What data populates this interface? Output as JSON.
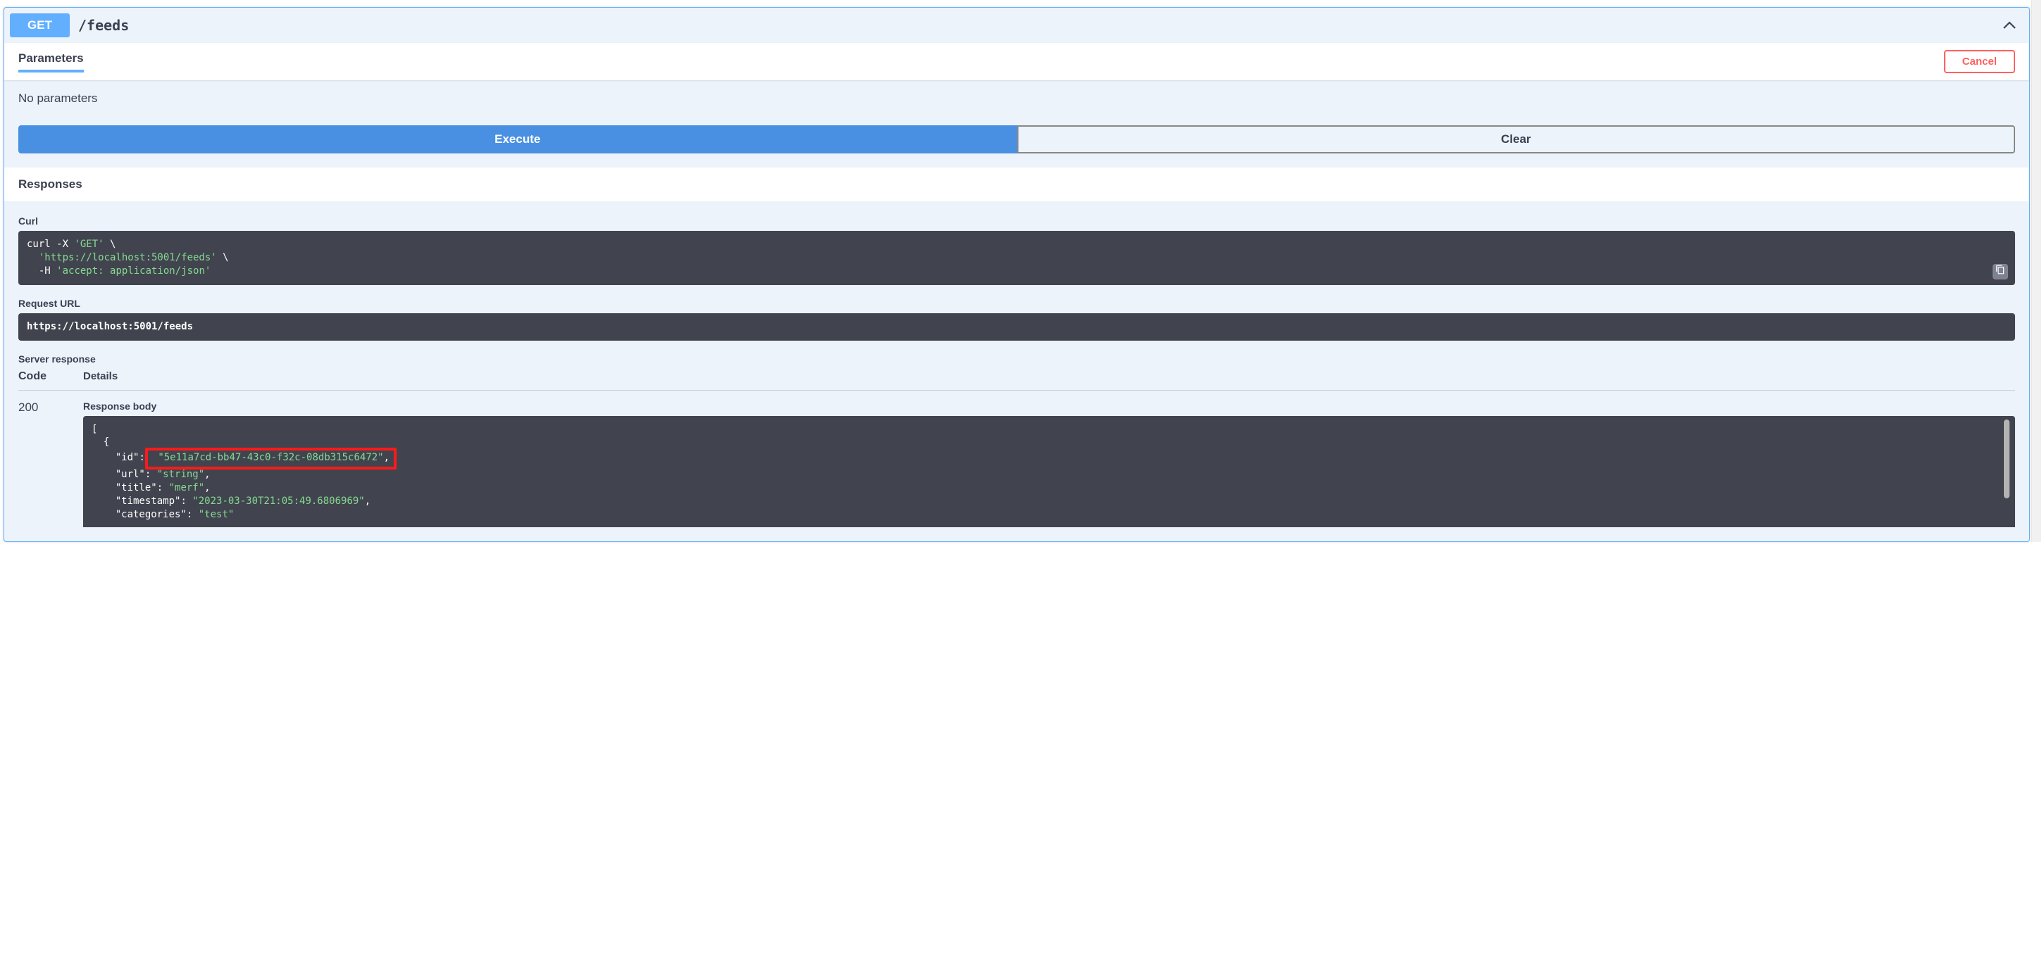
{
  "operation": {
    "method": "GET",
    "path": "/feeds"
  },
  "sections": {
    "parameters_label": "Parameters",
    "cancel_label": "Cancel",
    "no_parameters": "No parameters",
    "execute_label": "Execute",
    "clear_label": "Clear",
    "responses_label": "Responses",
    "curl_label": "Curl",
    "request_url_label": "Request URL",
    "server_response_label": "Server response",
    "code_header": "Code",
    "details_header": "Details",
    "response_body_label": "Response body"
  },
  "curl": {
    "l1_a": "curl -X ",
    "l1_b": "'GET'",
    "l1_c": " \\",
    "l2_a": "  ",
    "l2_b": "'https://localhost:5001/feeds'",
    "l2_c": " \\",
    "l3_a": "  -H ",
    "l3_b": "'accept: application/json'"
  },
  "request_url": "https://localhost:5001/feeds",
  "response": {
    "code": "200",
    "body": {
      "id_key": "\"id\"",
      "id_val": "\"5e11a7cd-bb47-43c0-f32c-08db315c6472\"",
      "url_key": "\"url\"",
      "url_val": "\"string\"",
      "title_key": "\"title\"",
      "title_val": "\"merf\"",
      "timestamp_key": "\"timestamp\"",
      "timestamp_val": "\"2023-03-30T21:05:49.6806969\"",
      "categories_key": "\"categories\"",
      "categories_val": "\"test\""
    }
  }
}
